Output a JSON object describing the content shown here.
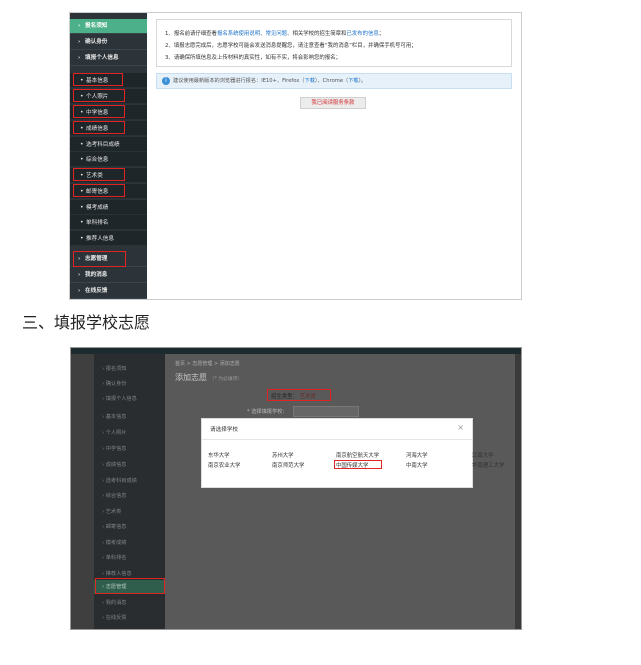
{
  "shot1": {
    "sidebar": [
      {
        "label": "报名须知",
        "kind": "arrow",
        "active": true
      },
      {
        "label": "确认身份",
        "kind": "arrow"
      },
      {
        "label": "填报个人信息",
        "kind": "arrow"
      },
      {
        "label": "基本信息",
        "kind": "dot"
      },
      {
        "label": "个人照片",
        "kind": "dot"
      },
      {
        "label": "中学信息",
        "kind": "dot"
      },
      {
        "label": "成绩信息",
        "kind": "dot"
      },
      {
        "label": "选考科目成绩",
        "kind": "dot"
      },
      {
        "label": "综合信息",
        "kind": "dot"
      },
      {
        "label": "艺术类",
        "kind": "dot"
      },
      {
        "label": "邮寄信息",
        "kind": "dot"
      },
      {
        "label": "模考成绩",
        "kind": "dot"
      },
      {
        "label": "单科排名",
        "kind": "dot"
      },
      {
        "label": "推荐人信息",
        "kind": "dot"
      },
      {
        "label": "志愿管理",
        "kind": "arrow"
      },
      {
        "label": "我的消息",
        "kind": "arrow"
      },
      {
        "label": "在线反馈",
        "kind": "arrow"
      }
    ],
    "notice": {
      "line1_a": "1、报名前请仔细查看",
      "line1_link1": "报名系统使用说明",
      "line1_sep": "、",
      "line1_link2": "常见问题",
      "line1_b": "、相关学校的招生简章和",
      "line1_link3": "已发布的信息",
      "line1_c": "；",
      "line2": "2、填报志愿完成后，志愿学校可能会发送消息提醒您，请注意查看“我的消息”栏目，并确保手机号可用；",
      "line3": "3、请确保所填信息及上传材料的真实性，如有不实，将会影响您的报名；"
    },
    "browser_tip": {
      "text_a": "建议使用最新版本的浏览器进行报名：IE10+、Firefox（",
      "link1": "下载",
      "text_b": "）、Chrome（",
      "link2": "下载",
      "text_c": "）。"
    },
    "print_button": "我已阅读服务条款"
  },
  "section_heading": "三、填报学校志愿",
  "shot2": {
    "sidebar": [
      {
        "label": "报名须知"
      },
      {
        "label": "确认身份"
      },
      {
        "label": "填报个人信息"
      },
      {
        "label": "基本信息"
      },
      {
        "label": "个人照片"
      },
      {
        "label": "中学信息"
      },
      {
        "label": "成绩信息"
      },
      {
        "label": "选考科目成绩"
      },
      {
        "label": "综合信息"
      },
      {
        "label": "艺术类"
      },
      {
        "label": "邮寄信息"
      },
      {
        "label": "模考成绩"
      },
      {
        "label": "单科排名"
      },
      {
        "label": "推荐人信息"
      },
      {
        "label": "志愿管理",
        "active": true
      },
      {
        "label": "我的消息"
      },
      {
        "label": "在线反馈"
      }
    ],
    "breadcrumb": "首页 > 志愿管理 > 添加志愿",
    "page_title": "添加志愿",
    "page_subtitle": "（* 为必填项）",
    "type_label": "招生类型：",
    "type_value": "艺术类",
    "choose_label": "* 选择填报学校：",
    "modal": {
      "title": "请选择学校",
      "close": "×",
      "universities": [
        "东华大学",
        "苏州大学",
        "南京航空航天大学",
        "河海大学",
        "江南大学",
        "南京农业大学",
        "南京师范大学",
        "中国传媒大学",
        "中南大学",
        "华南理工大学"
      ]
    }
  }
}
